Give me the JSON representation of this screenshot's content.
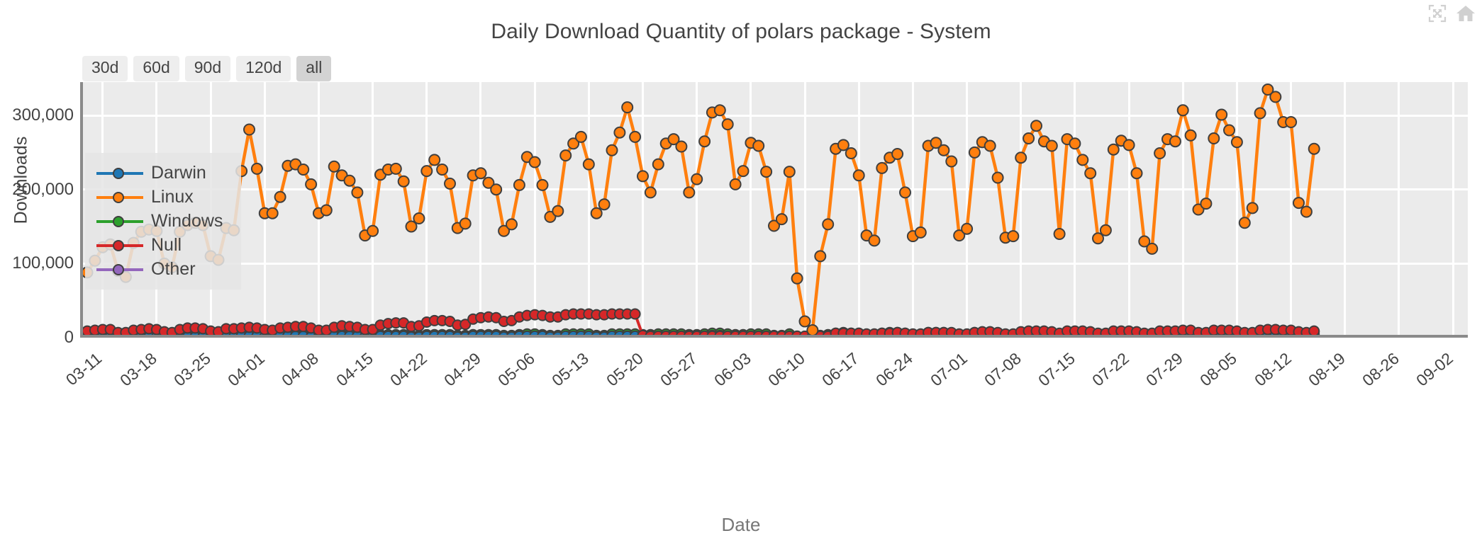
{
  "modebar": {
    "buttons": [
      {
        "name": "autoscale-icon",
        "title": "Autoscale"
      },
      {
        "name": "home-icon",
        "title": "Reset axes"
      }
    ]
  },
  "header": {
    "title": "Daily Download Quantity of polars package - System"
  },
  "rangeselector": {
    "buttons": [
      {
        "label": "30d",
        "active": false
      },
      {
        "label": "60d",
        "active": false
      },
      {
        "label": "90d",
        "active": false
      },
      {
        "label": "120d",
        "active": false
      },
      {
        "label": "all",
        "active": true
      }
    ]
  },
  "legend": {
    "items": [
      {
        "label": "Darwin",
        "color": "#1f77b4"
      },
      {
        "label": "Linux",
        "color": "#ff7f0e"
      },
      {
        "label": "Windows",
        "color": "#2ca02c"
      },
      {
        "label": "Null",
        "color": "#d62728"
      },
      {
        "label": "Other",
        "color": "#9467bd"
      }
    ]
  },
  "axes": {
    "x_title": "Date",
    "y_title": "Downloads",
    "y_ticks": [
      "0",
      "100,000",
      "200,000",
      "300,000"
    ],
    "x_ticks": [
      "03-11",
      "03-18",
      "03-25",
      "04-01",
      "04-08",
      "04-15",
      "04-22",
      "04-29",
      "05-06",
      "05-13",
      "05-20",
      "05-27",
      "06-03",
      "06-10",
      "06-17",
      "06-24",
      "07-01",
      "07-08",
      "07-15",
      "07-22",
      "07-29",
      "08-05",
      "08-12",
      "08-19",
      "08-26",
      "09-02"
    ]
  },
  "chart_data": {
    "type": "line",
    "title": "Daily Download Quantity of polars package - System",
    "xlabel": "Date",
    "ylabel": "Downloads",
    "ylim": [
      0,
      345000
    ],
    "xlim": [
      "03-09",
      "09-03"
    ],
    "grid": true,
    "legend_position": "top-left-inside",
    "x_tick_step_days": 7,
    "x": [
      "03-09",
      "03-10",
      "03-11",
      "03-12",
      "03-13",
      "03-14",
      "03-15",
      "03-16",
      "03-17",
      "03-18",
      "03-19",
      "03-20",
      "03-21",
      "03-22",
      "03-23",
      "03-24",
      "03-25",
      "03-26",
      "03-27",
      "03-28",
      "03-29",
      "03-30",
      "03-31",
      "04-01",
      "04-02",
      "04-03",
      "04-04",
      "04-05",
      "04-06",
      "04-07",
      "04-08",
      "04-09",
      "04-10",
      "04-11",
      "04-12",
      "04-13",
      "04-14",
      "04-15",
      "04-16",
      "04-17",
      "04-18",
      "04-19",
      "04-20",
      "04-21",
      "04-22",
      "04-23",
      "04-24",
      "04-25",
      "04-26",
      "04-27",
      "04-28",
      "04-29",
      "04-30",
      "05-01",
      "05-02",
      "05-03",
      "05-04",
      "05-05",
      "05-06",
      "05-07",
      "05-08",
      "05-09",
      "05-10",
      "05-11",
      "05-12",
      "05-13",
      "05-14",
      "05-15",
      "05-16",
      "05-17",
      "05-18",
      "05-19",
      "05-20",
      "05-21",
      "05-22",
      "05-23",
      "05-24",
      "05-25",
      "05-26",
      "05-27",
      "05-28",
      "05-29",
      "05-30",
      "05-31",
      "06-01",
      "06-02",
      "06-03",
      "06-04",
      "06-05",
      "06-06",
      "06-07",
      "06-08",
      "06-09",
      "06-10",
      "06-11",
      "06-12",
      "06-13",
      "06-14",
      "06-15",
      "06-16",
      "06-17",
      "06-18",
      "06-19",
      "06-20",
      "06-21",
      "06-22",
      "06-23",
      "06-24",
      "06-25",
      "06-26",
      "06-27",
      "06-28",
      "06-29",
      "06-30",
      "07-01",
      "07-02",
      "07-03",
      "07-04",
      "07-05",
      "07-06",
      "07-07",
      "07-08",
      "07-09",
      "07-10",
      "07-11",
      "07-12",
      "07-13",
      "07-14",
      "07-15",
      "07-16",
      "07-17",
      "07-18",
      "07-19",
      "07-20",
      "07-21",
      "07-22",
      "07-23",
      "07-24",
      "07-25",
      "07-26",
      "07-27",
      "07-28",
      "07-29",
      "07-30",
      "07-31",
      "08-01",
      "08-02",
      "08-03",
      "08-04",
      "08-05",
      "08-06",
      "08-07",
      "08-08",
      "08-09",
      "08-10",
      "08-11",
      "08-12",
      "08-13",
      "08-14",
      "08-15",
      "08-16",
      "08-17",
      "08-18",
      "08-19",
      "08-20",
      "08-21",
      "08-22",
      "08-23",
      "08-24",
      "08-25",
      "08-26",
      "08-27",
      "08-28",
      "08-29",
      "08-30",
      "08-31",
      "09-01",
      "09-02",
      "09-03"
    ],
    "series": [
      {
        "name": "Linux",
        "color": "#ff7f0e",
        "values": [
          88000,
          104000,
          122000,
          126000,
          90000,
          82000,
          128000,
          143000,
          146000,
          144000,
          100000,
          95000,
          143000,
          152000,
          155000,
          152000,
          110000,
          105000,
          148000,
          145000,
          225000,
          281000,
          228000,
          168000,
          168000,
          190000,
          232000,
          234000,
          227000,
          207000,
          168000,
          172000,
          231000,
          219000,
          212000,
          196000,
          138000,
          144000,
          220000,
          227000,
          228000,
          211000,
          150000,
          161000,
          225000,
          240000,
          227000,
          208000,
          148000,
          154000,
          219000,
          222000,
          209000,
          200000,
          144000,
          153000,
          206000,
          244000,
          237000,
          206000,
          163000,
          171000,
          246000,
          262000,
          271000,
          234000,
          168000,
          180000,
          253000,
          277000,
          311000,
          271000,
          218000,
          196000,
          234000,
          262000,
          268000,
          258000,
          196000,
          214000,
          265000,
          304000,
          307000,
          288000,
          207000,
          225000,
          263000,
          259000,
          224000,
          151000,
          160000,
          224000,
          80000,
          22000,
          10000,
          110000,
          153000,
          255000,
          260000,
          249000,
          219000,
          138000,
          131000,
          229000,
          243000,
          248000,
          196000,
          137000,
          142000,
          259000,
          263000,
          253000,
          238000,
          138000,
          147000,
          250000,
          264000,
          259000,
          216000,
          135000,
          137000,
          243000,
          269000,
          286000,
          265000,
          259000,
          140000,
          268000,
          262000,
          240000,
          222000,
          134000,
          145000,
          254000,
          266000,
          260000,
          222000,
          130000,
          120000,
          249000,
          268000,
          265000,
          307000,
          273000,
          173000,
          181000,
          269000,
          301000,
          280000,
          264000,
          155000,
          175000,
          303000,
          335000,
          325000,
          291000,
          291000,
          182000,
          170000,
          255000
        ]
      },
      {
        "name": "Null",
        "color": "#d62728",
        "values": [
          9000,
          10000,
          11000,
          11000,
          7000,
          7000,
          10000,
          11000,
          12000,
          11000,
          8000,
          7000,
          11000,
          13000,
          13000,
          12000,
          9000,
          8000,
          12000,
          12000,
          13000,
          14000,
          13000,
          11000,
          10000,
          13000,
          14000,
          15000,
          15000,
          13000,
          10000,
          10000,
          14000,
          16000,
          15000,
          14000,
          11000,
          11000,
          17000,
          19000,
          20000,
          20000,
          15000,
          16000,
          21000,
          23000,
          23000,
          22000,
          17000,
          18000,
          25000,
          27000,
          28000,
          27000,
          22000,
          23000,
          28000,
          30000,
          31000,
          30000,
          28000,
          28000,
          31000,
          32000,
          32000,
          32000,
          31000,
          31000,
          32000,
          32000,
          32000,
          32000,
          3000,
          2000,
          2000,
          2000,
          2000,
          2000,
          2000,
          2000,
          2000,
          2000,
          2000,
          2000,
          2000,
          2000,
          2000,
          2000,
          2000,
          2000,
          2000,
          2000,
          2000,
          2000,
          2000,
          2000,
          2000,
          6000,
          6000,
          6000,
          6000,
          5000,
          5000,
          6000,
          6000,
          7000,
          6000,
          5000,
          5000,
          7000,
          7000,
          7000,
          7000,
          5000,
          5000,
          7000,
          8000,
          8000,
          7000,
          5000,
          5000,
          8000,
          9000,
          9000,
          9000,
          8000,
          6000,
          9000,
          9000,
          9000,
          8000,
          6000,
          6000,
          9000,
          9000,
          9000,
          8000,
          6000,
          6000,
          9000,
          9000,
          9000,
          10000,
          10000,
          7000,
          7000,
          10000,
          10000,
          10000,
          9000,
          7000,
          7000,
          10000,
          11000,
          11000,
          10000,
          10000,
          8000,
          7000,
          9000
        ]
      },
      {
        "name": "Other",
        "color": "#9467bd",
        "values": [
          1000,
          1000,
          1000,
          1000,
          900,
          900,
          1000,
          1000,
          1000,
          1000,
          900,
          900,
          1000,
          1000,
          1000,
          1000,
          900,
          900,
          1000,
          1000,
          1000,
          1000,
          1000,
          1000,
          1000,
          1000,
          1000,
          1000,
          1000,
          1000,
          900,
          900,
          1000,
          1000,
          1000,
          1000,
          900,
          900,
          1000,
          1000,
          1000,
          1000,
          900,
          900,
          1000,
          1000,
          1000,
          1000,
          900,
          900,
          1000,
          1000,
          1000,
          1000,
          900,
          900,
          1000,
          1000,
          1000,
          1000,
          900,
          900,
          1000,
          1000,
          1000,
          1000,
          900,
          900,
          1000,
          1000,
          1000,
          1000,
          900,
          900,
          1000,
          1000,
          1000,
          1000,
          900,
          900,
          1000,
          1000,
          1000,
          1000,
          900,
          900,
          1000,
          1000,
          1000,
          900,
          900,
          1000,
          900,
          800,
          800,
          900,
          900,
          1000,
          1000,
          1000,
          1000,
          900,
          900,
          1000,
          1000,
          1000,
          1000,
          900,
          900,
          1000,
          1000,
          1000,
          1000,
          900,
          900,
          1000,
          1000,
          1000,
          1000,
          900,
          900,
          1000,
          1000,
          1000,
          1000,
          1000,
          900,
          1000,
          1000,
          1000,
          1000,
          900,
          900,
          1000,
          1000,
          1000,
          1000,
          900,
          900,
          1000,
          1000,
          1000,
          1000,
          1000,
          900,
          900,
          1000,
          1000,
          1000,
          1000,
          900,
          900,
          1000,
          1000,
          1000,
          1000,
          1000,
          900,
          900,
          1000
        ]
      },
      {
        "name": "Windows",
        "color": "#2ca02c",
        "values": [
          2000,
          2000,
          3000,
          3000,
          2000,
          2000,
          3000,
          3000,
          3000,
          3000,
          2000,
          2000,
          3000,
          3000,
          3000,
          3000,
          2000,
          2000,
          3000,
          3000,
          4000,
          4000,
          4000,
          3000,
          3000,
          4000,
          4000,
          4000,
          4000,
          3000,
          3000,
          3000,
          4000,
          4000,
          4000,
          4000,
          3000,
          3000,
          4000,
          4000,
          4000,
          4000,
          3000,
          3000,
          4000,
          4000,
          4000,
          4000,
          3000,
          3000,
          4000,
          4000,
          4000,
          4000,
          3000,
          3000,
          4000,
          5000,
          5000,
          4000,
          3000,
          3000,
          5000,
          5000,
          5000,
          5000,
          3000,
          3000,
          5000,
          5000,
          5000,
          5000,
          4000,
          4000,
          5000,
          5000,
          5000,
          5000,
          4000,
          4000,
          5000,
          6000,
          6000,
          5000,
          4000,
          4000,
          5000,
          5000,
          5000,
          3000,
          3000,
          5000,
          2000,
          1000,
          1000,
          3000,
          4000,
          6000,
          7000,
          6000,
          6000,
          4000,
          4000,
          6000,
          7000,
          7000,
          6000,
          4000,
          4000,
          7000,
          7000,
          7000,
          6000,
          4000,
          4000,
          7000,
          7000,
          7000,
          6000,
          4000,
          4000,
          7000,
          8000,
          8000,
          7000,
          7000,
          4000,
          8000,
          8000,
          7000,
          7000,
          4000,
          4000,
          8000,
          8000,
          8000,
          7000,
          4000,
          4000,
          7000,
          8000,
          8000,
          9000,
          8000,
          5000,
          5000,
          8000,
          9000,
          8000,
          8000,
          5000,
          5000,
          9000,
          10000,
          9000,
          9000,
          9000,
          5000,
          5000,
          8000
        ]
      },
      {
        "name": "Darwin",
        "color": "#1f77b4",
        "values": [
          1000,
          1000,
          1000,
          1000,
          900,
          900,
          1000,
          1000,
          1000,
          1000,
          900,
          900,
          1000,
          1000,
          1000,
          1000,
          900,
          900,
          1000,
          1000,
          2000,
          2000,
          2000,
          1000,
          1000,
          2000,
          2000,
          2000,
          2000,
          1000,
          1000,
          1000,
          2000,
          2000,
          2000,
          2000,
          1000,
          1000,
          2000,
          2000,
          2000,
          2000,
          1000,
          1000,
          2000,
          2000,
          2000,
          2000,
          1000,
          1000,
          2000,
          2000,
          2000,
          2000,
          1000,
          1000,
          2000,
          2000,
          2000,
          2000,
          1000,
          1000,
          2000,
          2000,
          2000,
          2000,
          1000,
          1000,
          2000,
          2000,
          2000,
          2000,
          2000,
          2000,
          2000,
          2000,
          2000,
          2000,
          2000,
          2000,
          2000,
          3000,
          3000,
          2000,
          2000,
          2000,
          2000,
          2000,
          2000,
          1000,
          1000,
          2000,
          1000,
          500,
          500,
          1000,
          2000,
          3000,
          3000,
          3000,
          3000,
          2000,
          2000,
          3000,
          3000,
          3000,
          3000,
          2000,
          2000,
          3000,
          4000,
          4000,
          3000,
          2000,
          2000,
          4000,
          4000,
          4000,
          3000,
          2000,
          2000,
          4000,
          5000,
          5000,
          4000,
          4000,
          2000,
          5000,
          5000,
          4000,
          4000,
          2000,
          2000,
          5000,
          5000,
          5000,
          4000,
          2000,
          2000,
          4000,
          5000,
          5000,
          5000,
          5000,
          3000,
          3000,
          5000,
          5000,
          5000,
          5000,
          3000,
          3000,
          5000,
          6000,
          6000,
          5000,
          5000,
          3000,
          3000,
          5000
        ]
      }
    ]
  }
}
